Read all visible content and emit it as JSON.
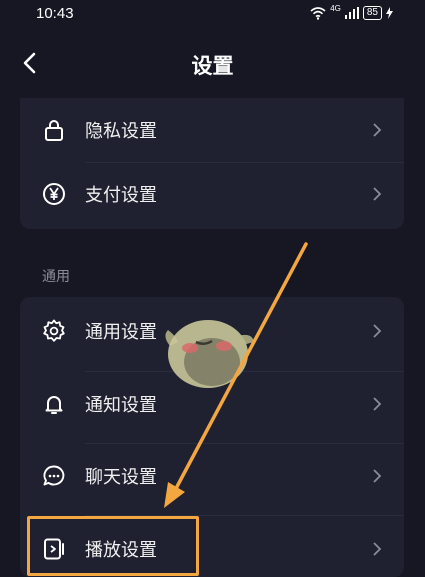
{
  "status_bar": {
    "time": "10:43",
    "network": "4G",
    "battery": "85"
  },
  "nav": {
    "title": "设置"
  },
  "privacy_group": {
    "items": [
      {
        "label": "隐私设置",
        "icon": "lock-icon"
      },
      {
        "label": "支付设置",
        "icon": "yen-icon"
      }
    ]
  },
  "general_section": {
    "title": "通用",
    "items": [
      {
        "label": "通用设置",
        "icon": "gear-icon"
      },
      {
        "label": "通知设置",
        "icon": "bell-icon"
      },
      {
        "label": "聊天设置",
        "icon": "chat-bubble-icon"
      },
      {
        "label": "播放设置",
        "icon": "play-panel-icon"
      }
    ]
  },
  "colors": {
    "background": "#161722",
    "card": "#1f2130",
    "highlight": "#f4a741",
    "muted_text": "#8a8c99"
  }
}
